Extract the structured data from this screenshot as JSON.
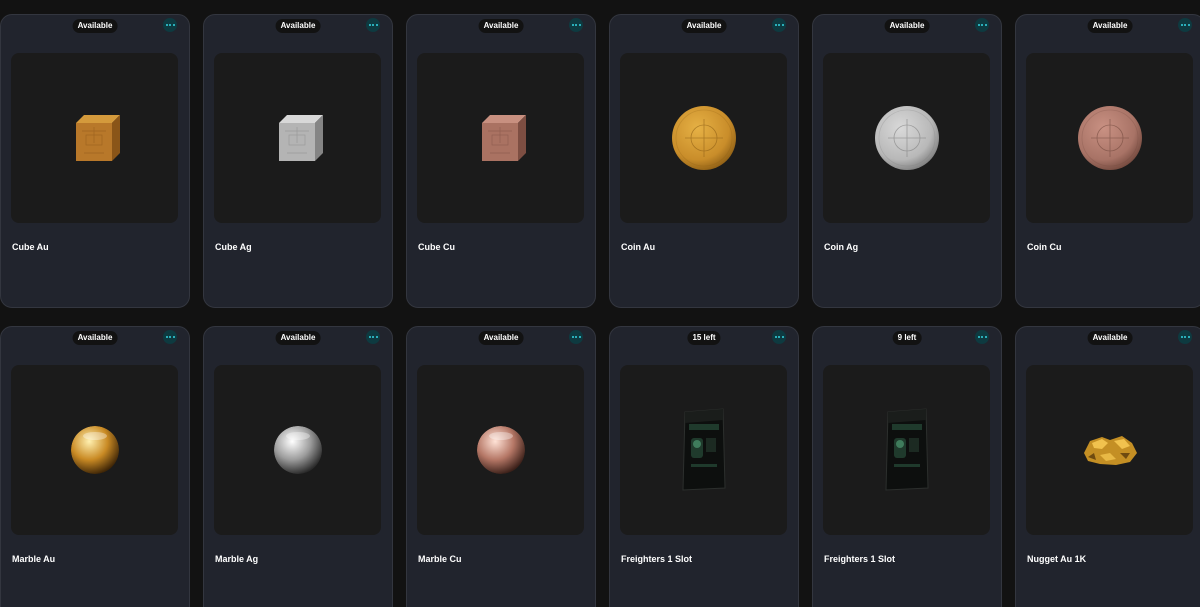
{
  "items": [
    {
      "title": "Cube Au",
      "badge": "Available",
      "media": {
        "icon": "gold-cube-icon",
        "shape": "cube",
        "colors": [
          "#d49a3c",
          "#b8782a",
          "#8a5518"
        ]
      }
    },
    {
      "title": "Cube Ag",
      "badge": "Available",
      "media": {
        "icon": "silver-cube-icon",
        "shape": "cube",
        "colors": [
          "#d8d8d8",
          "#b4b4b4",
          "#858585"
        ]
      }
    },
    {
      "title": "Cube Cu",
      "badge": "Available",
      "media": {
        "icon": "copper-cube-icon",
        "shape": "cube",
        "colors": [
          "#c89080",
          "#aa7262",
          "#7d4e42"
        ]
      }
    },
    {
      "title": "Coin Au",
      "badge": "Available",
      "media": {
        "icon": "gold-coin-icon",
        "shape": "coin",
        "colors": [
          "#e6b145",
          "#c98d2a",
          "#8a5c14"
        ]
      }
    },
    {
      "title": "Coin Ag",
      "badge": "Available",
      "media": {
        "icon": "silver-coin-icon",
        "shape": "coin",
        "colors": [
          "#d9d9d9",
          "#b8b8b8",
          "#7a7a7a"
        ]
      }
    },
    {
      "title": "Coin Cu",
      "badge": "Available",
      "media": {
        "icon": "copper-coin-icon",
        "shape": "coin",
        "colors": [
          "#c99183",
          "#a87366",
          "#6f463b"
        ]
      }
    },
    {
      "title": "Marble Au",
      "badge": "Available",
      "media": {
        "icon": "gold-marble-icon",
        "shape": "marble",
        "colors": [
          "#fff0b0",
          "#c98a24",
          "#3f2607"
        ]
      }
    },
    {
      "title": "Marble Ag",
      "badge": "Available",
      "media": {
        "icon": "silver-marble-icon",
        "shape": "marble",
        "colors": [
          "#ffffff",
          "#9c9c9c",
          "#2a2a2a"
        ]
      }
    },
    {
      "title": "Marble Cu",
      "badge": "Available",
      "media": {
        "icon": "copper-marble-icon",
        "shape": "marble",
        "colors": [
          "#ffe2d6",
          "#b57766",
          "#3b2019"
        ]
      }
    },
    {
      "title": "Freighters 1 Slot",
      "badge": "15 left",
      "media": {
        "icon": "freighter-pack-icon",
        "shape": "pack",
        "colors": [
          "#0d0f0e",
          "#1f3a2c",
          "#3f7c5c"
        ]
      }
    },
    {
      "title": "Freighters 1 Slot",
      "badge": "9 left",
      "media": {
        "icon": "freighter-pack-icon",
        "shape": "pack",
        "colors": [
          "#0d0f0e",
          "#1f3a2c",
          "#3f7c5c"
        ]
      }
    },
    {
      "title": "Nugget Au 1K",
      "badge": "Available",
      "media": {
        "icon": "gold-nugget-icon",
        "shape": "nugget",
        "colors": [
          "#f1c24e",
          "#c48f24",
          "#6e4a10"
        ]
      }
    }
  ],
  "theme": {
    "card_bg": "#21242d",
    "menu_accent": "#34d3e0",
    "page_bg": "#121212"
  }
}
